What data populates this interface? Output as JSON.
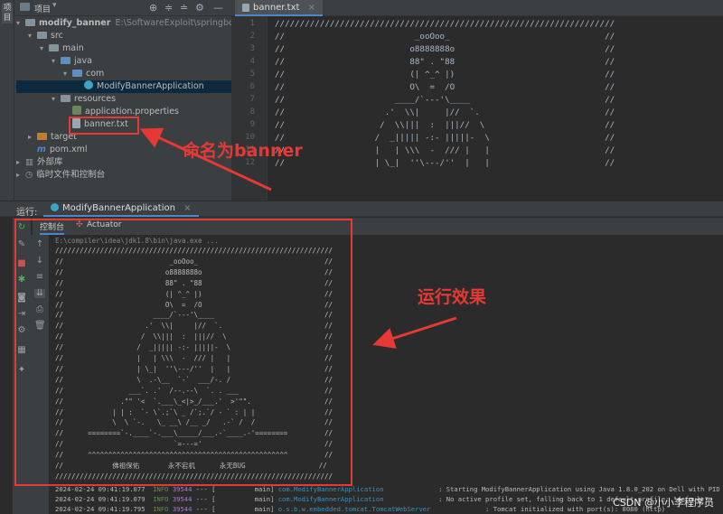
{
  "strip": {
    "label": "项目"
  },
  "project_panel": {
    "title": "项目",
    "tree": [
      {
        "label": "modify_banner",
        "extra": "E:\\SoftwareExploit\\springboot2...",
        "indent": 0,
        "type": "folder",
        "expanded": true
      },
      {
        "label": "src",
        "indent": 1,
        "type": "folder",
        "expanded": true
      },
      {
        "label": "main",
        "indent": 2,
        "type": "folder",
        "expanded": true
      },
      {
        "label": "java",
        "indent": 3,
        "type": "folder-blue",
        "expanded": true
      },
      {
        "label": "com",
        "indent": 4,
        "type": "package",
        "expanded": true
      },
      {
        "label": "ModifyBannerApplication",
        "indent": 5,
        "type": "class",
        "selected": true
      },
      {
        "label": "resources",
        "indent": 3,
        "type": "folder",
        "expanded": true
      },
      {
        "label": "application.properties",
        "indent": 4,
        "type": "properties"
      },
      {
        "label": "banner.txt",
        "indent": 4,
        "type": "file"
      },
      {
        "label": "target",
        "indent": 1,
        "type": "folder-orange",
        "expanded": false
      },
      {
        "label": "pom.xml",
        "indent": 1,
        "type": "maven"
      },
      {
        "label": "外部库",
        "indent": 0,
        "type": "lib",
        "expanded": false
      },
      {
        "label": "临时文件和控制台",
        "indent": 0,
        "type": "scratch",
        "expanded": false
      }
    ]
  },
  "editor": {
    "tab": "banner.txt",
    "lines": [
      "////////////////////////////////////////////////////////////////////",
      "//                          _ooOoo_                               //",
      "//                         o8888888o                              //",
      "//                         88\" . \"88                              //",
      "//                         (| ^_^ |)                              //",
      "//                         O\\  =  /O                              //",
      "//                      ____/`---'\\____                           //",
      "//                    .'  \\\\|     |//  `.                         //",
      "//                   /  \\\\|||  :  |||//  \\                        //",
      "//                  /  _||||| -:- |||||-  \\                       //",
      "//                  |   | \\\\\\  -  /// |   |                       //",
      "//                  | \\_|  ''\\---/''  |   |                       //"
    ]
  },
  "run": {
    "label": "运行:",
    "tab": "ModifyBannerApplication",
    "subtabs": [
      "控制台",
      "Actuator"
    ],
    "command": "E:\\compiler\\idea\\jdk1.8\\bin\\java.exe ...",
    "banner": [
      "////////////////////////////////////////////////////////////////////",
      "//                          _ooOoo_                               //",
      "//                         o8888888o                              //",
      "//                         88\" . \"88                              //",
      "//                         (| ^_^ |)                              //",
      "//                         O\\  =  /O                              //",
      "//                      ____/`---'\\____                           //",
      "//                    .'  \\\\|     |//  `.                         //",
      "//                   /  \\\\|||  :  |||//  \\                        //",
      "//                  /  _||||| -:- |||||-  \\                       //",
      "//                  |   | \\\\\\  -  /// |   |                       //",
      "//                  | \\_|  ''\\---/''  |   |                       //",
      "//                  \\  .-\\__  `-`  ___/-. /                       //",
      "//                ___`. .'  /--.--\\  `. . ___                     //",
      "//              .\"\" '<  `.___\\_<|>_/___.'  >'\"\".                  //",
      "//            | | :  `- \\`.;`\\ _ /`;.`/ - ` : | |                 //",
      "//            \\  \\ `-.   \\_ __\\ /__ _/   .-` /  /                 //",
      "//      ========`-.____`-.___\\_____/___.-`____.-'========         //",
      "//                           `=---='                              //",
      "//      ^^^^^^^^^^^^^^^^^^^^^^^^^^^^^^^^^^^^^^^^^^^^^^^^^         //",
      "//            佛祖保佑       永不宕机      永无BUG                  //",
      "////////////////////////////////////////////////////////////////////"
    ],
    "logs": [
      {
        "time": "2024-02-24 09:41:19.077",
        "level": "INFO",
        "pid": "39544",
        "thread": "main",
        "logger": "com.ModifyBannerApplication",
        "msg": ": Starting ModifyBannerApplication using Java 1.8.0_202 on Dell with PID 39544"
      },
      {
        "time": "2024-02-24 09:41:19.079",
        "level": "INFO",
        "pid": "39544",
        "thread": "main",
        "logger": "com.ModifyBannerApplication",
        "msg": ": No active profile set, falling back to 1 default profile: \"default\""
      },
      {
        "time": "2024-02-24 09:41:19.795",
        "level": "INFO",
        "pid": "39544",
        "thread": "main",
        "logger": "o.s.b.w.embedded.tomcat.TomcatWebServer",
        "msg": ": Tomcat initialized with port(s): 8080 (http)"
      }
    ]
  },
  "annotations": {
    "rename": "命名为banner",
    "effect": "运行效果"
  },
  "watermark": "CSDN @小小李程序员",
  "colors": {
    "annotation": "#e53935",
    "info": "#6a8759",
    "logger": "#3d8fb7"
  }
}
